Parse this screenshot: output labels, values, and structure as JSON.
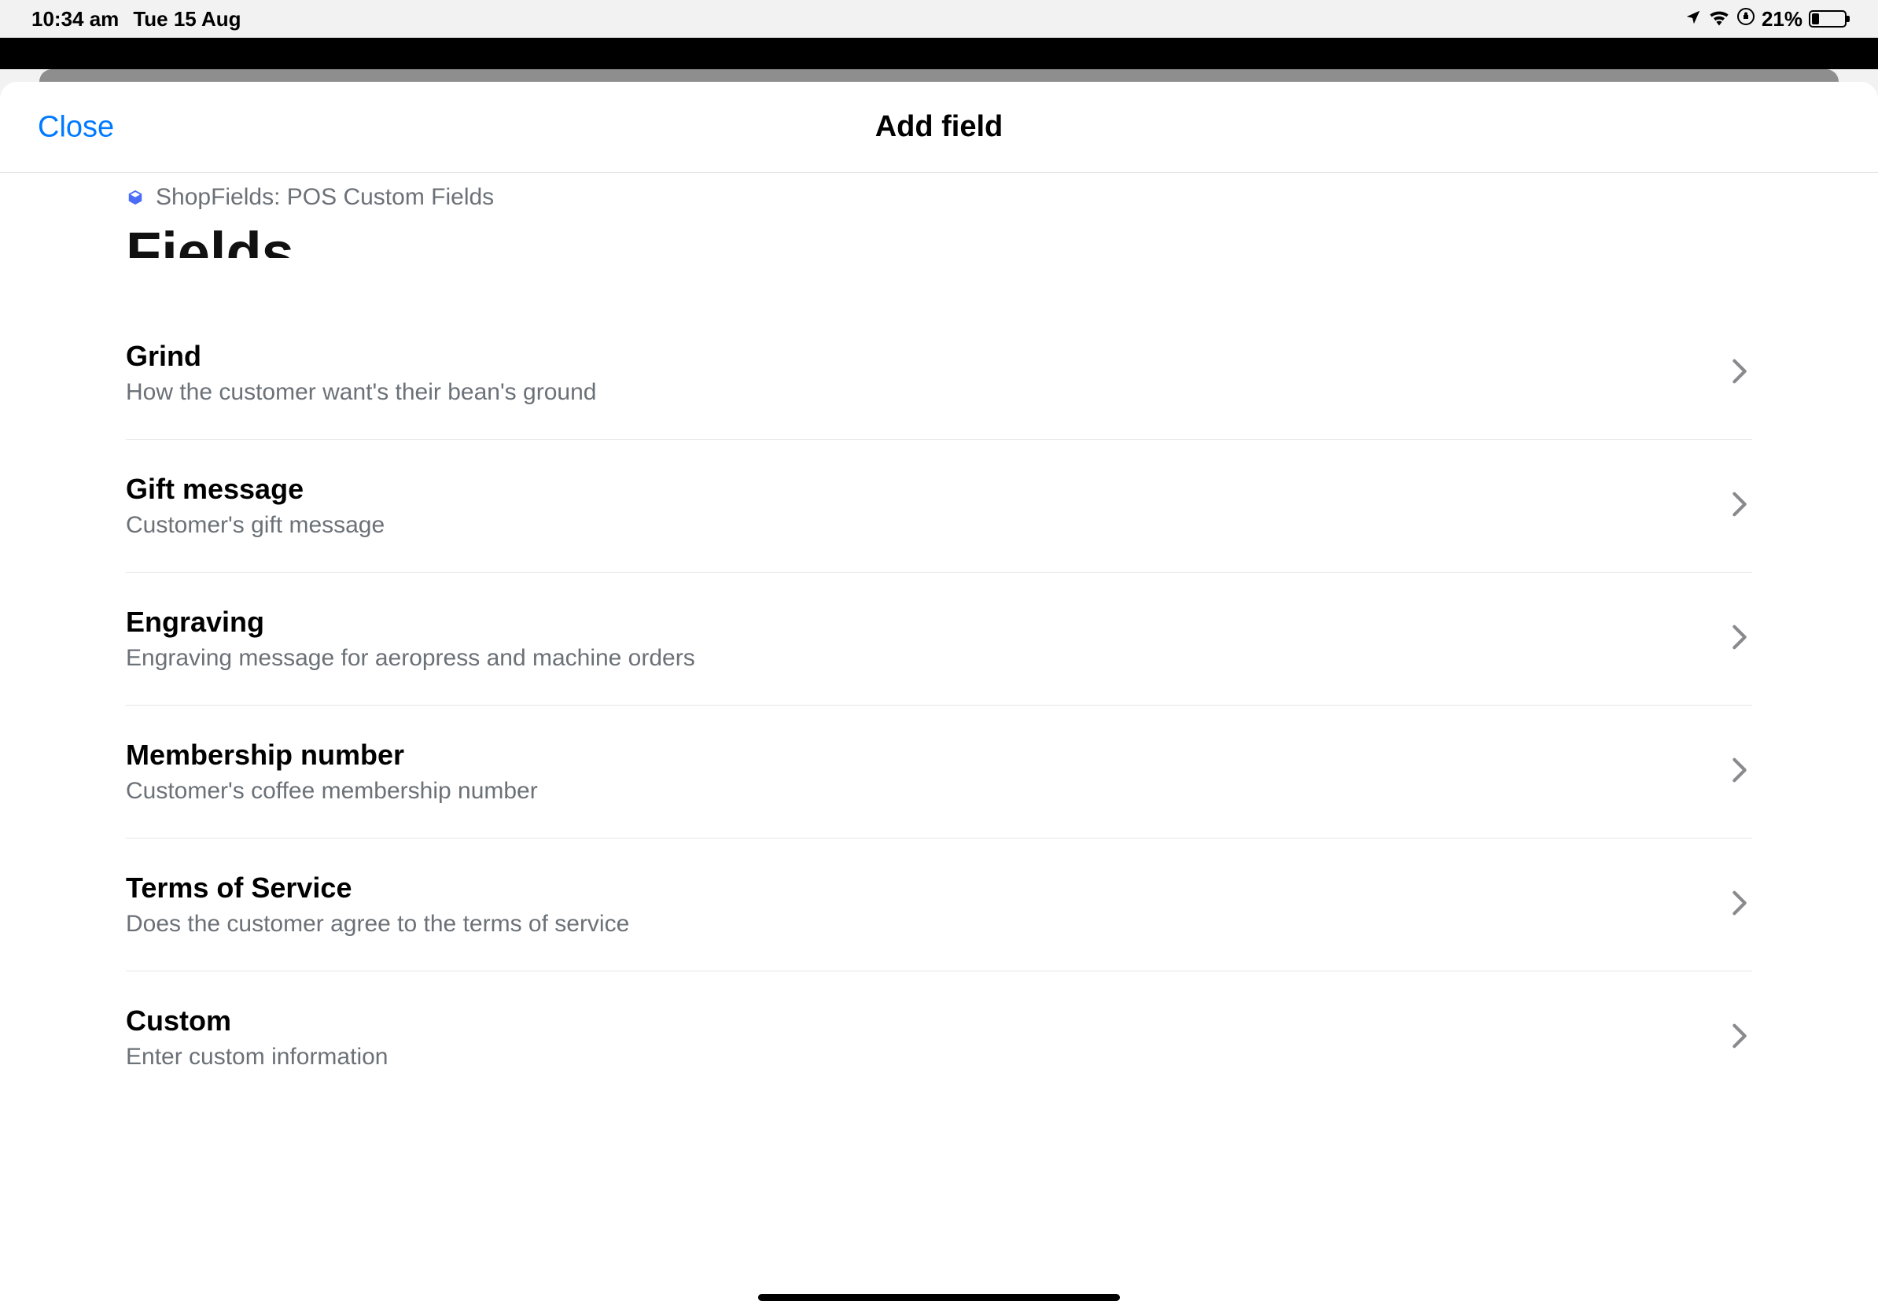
{
  "status_bar": {
    "time": "10:34 am",
    "date": "Tue 15 Aug",
    "battery_pct": "21%"
  },
  "modal": {
    "close_label": "Close",
    "title": "Add field",
    "app_name": "ShopFields: POS Custom Fields",
    "section_heading": "Fields"
  },
  "fields": [
    {
      "title": "Grind",
      "desc": "How the customer want's their bean's ground"
    },
    {
      "title": "Gift message",
      "desc": "Customer's gift message"
    },
    {
      "title": "Engraving",
      "desc": "Engraving message for aeropress and machine orders"
    },
    {
      "title": "Membership number",
      "desc": "Customer's coffee membership number"
    },
    {
      "title": "Terms of Service",
      "desc": "Does the customer agree to the terms of service"
    },
    {
      "title": "Custom",
      "desc": "Enter custom information"
    }
  ]
}
